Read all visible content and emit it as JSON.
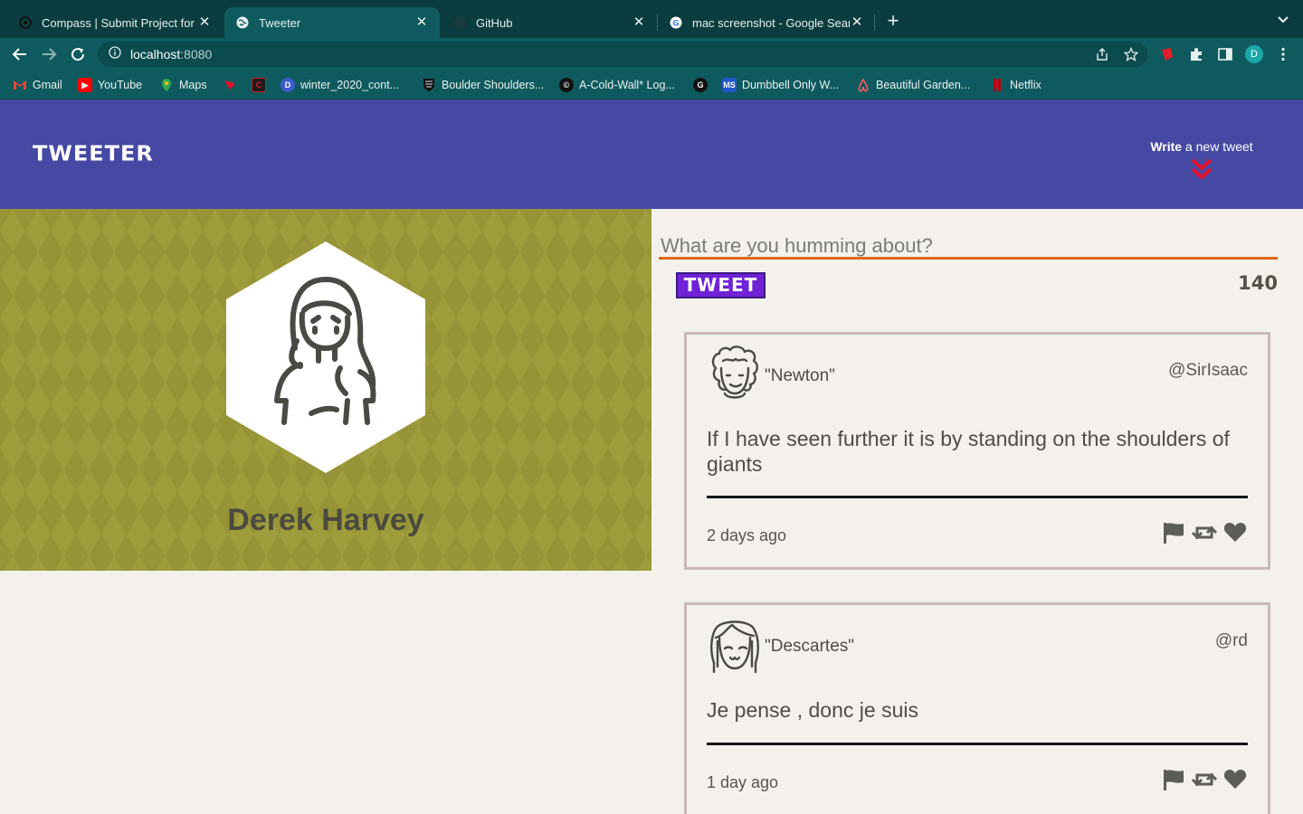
{
  "browser": {
    "tabs": [
      {
        "title": "Compass | Submit Project for E",
        "icon": "compass-icon",
        "active": false
      },
      {
        "title": "Tweeter",
        "icon": "globe-icon",
        "active": true
      },
      {
        "title": "GitHub",
        "icon": "github-icon",
        "active": false
      },
      {
        "title": "mac screenshot - Google Sear",
        "icon": "google-icon",
        "active": false
      }
    ],
    "url_host": "localhost",
    "url_port": ":8080",
    "profile_initial": "D",
    "bookmarks": [
      {
        "label": "Gmail",
        "icon": "gmail-icon"
      },
      {
        "label": "YouTube",
        "icon": "youtube-icon"
      },
      {
        "label": "Maps",
        "icon": "maps-icon"
      },
      {
        "label": "",
        "icon": "bookmark-red-icon"
      },
      {
        "label": "",
        "icon": "bookmark-c-icon"
      },
      {
        "label": "winter_2020_cont...",
        "icon": "d-icon"
      },
      {
        "label": "Boulder Shoulders...",
        "icon": "shield-icon"
      },
      {
        "label": "A-Cold-Wall* Log...",
        "icon": "acw-icon"
      },
      {
        "label": "",
        "icon": "g-icon"
      },
      {
        "label": "Dumbbell Only W...",
        "icon": "ms-icon"
      },
      {
        "label": "Beautiful Garden...",
        "icon": "airbnb-icon"
      },
      {
        "label": "Netflix",
        "icon": "netflix-icon"
      }
    ]
  },
  "nav": {
    "logo": "TWEETER",
    "compose_bold": "Write",
    "compose_rest": " a new tweet"
  },
  "profile": {
    "name": "Derek Harvey"
  },
  "compose": {
    "placeholder": "What are you humming about?",
    "button": "TWEET",
    "counter": "140"
  },
  "tweets": [
    {
      "name": "\"Newton\"",
      "handle": "@SirIsaac",
      "text": "If I have seen further it is by standing on the shoulders of giants",
      "time": "2 days ago"
    },
    {
      "name": "\"Descartes\"",
      "handle": "@rd",
      "text": "Je pense , donc je suis",
      "time": "1 day ago"
    }
  ],
  "colors": {
    "nav_bg": "#4649a3",
    "profile_bg": "#9f9c3b",
    "page_bg": "#f4f1ec",
    "tweet_button": "#6f22d6",
    "compose_underline": "#e06a10",
    "chevron": "#e0102a"
  }
}
